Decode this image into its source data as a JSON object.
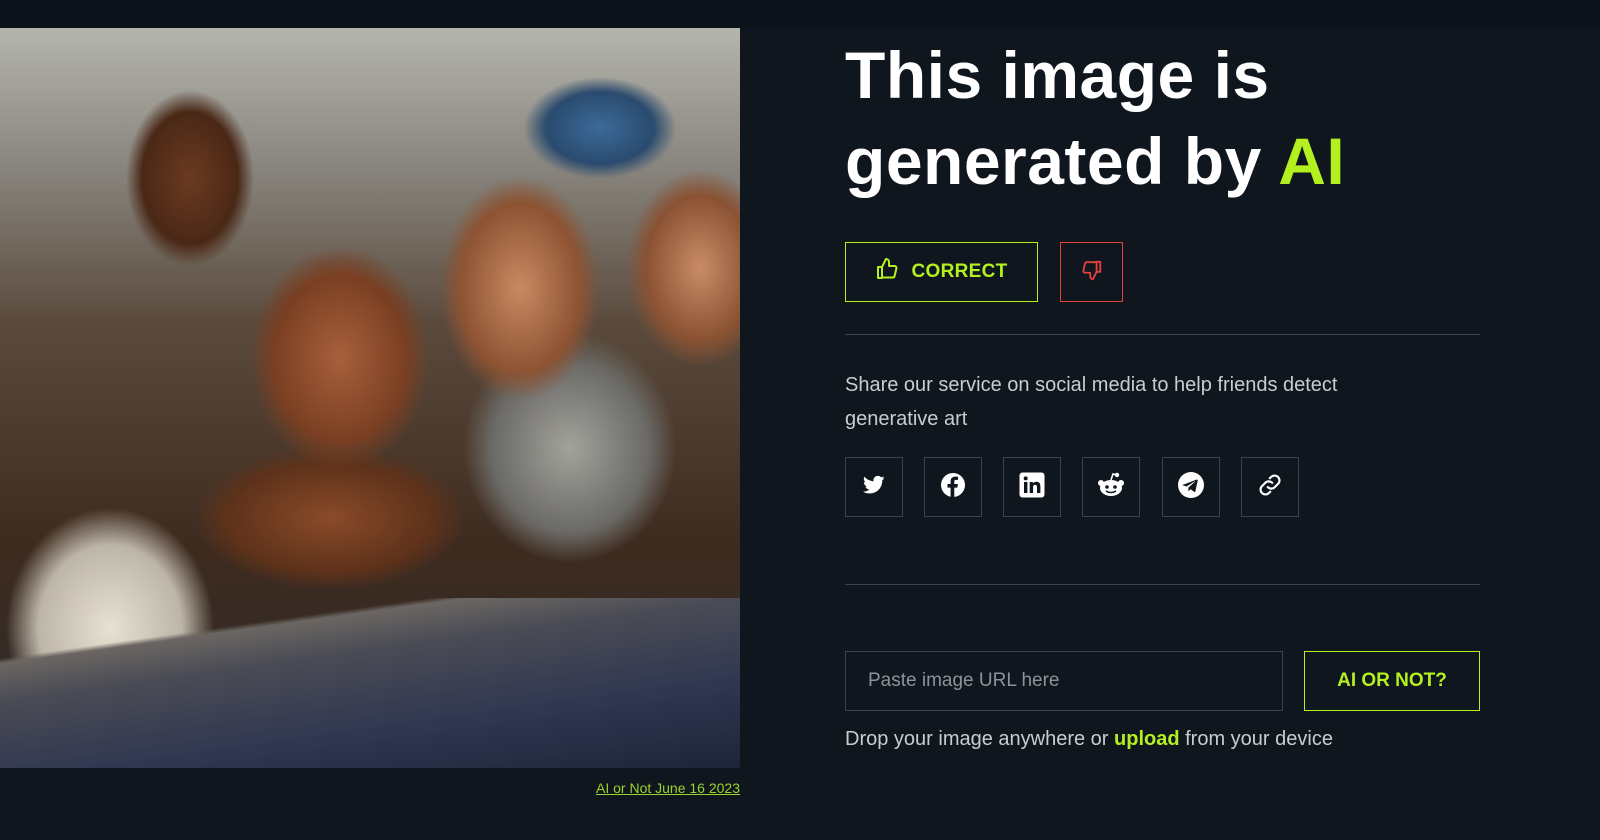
{
  "image_credit": "AI or Not June 16 2023",
  "result": {
    "headline_prefix": "This image is generated by ",
    "headline_highlight": "AI",
    "correct_label": "CORRECT"
  },
  "share": {
    "text": "Share our service on social media to help friends detect generative art",
    "networks": [
      "twitter-icon",
      "facebook-icon",
      "linkedin-icon",
      "reddit-icon",
      "telegram-icon",
      "link-icon"
    ]
  },
  "checker": {
    "url_placeholder": "Paste image URL here",
    "submit_label": "AI OR NOT?",
    "drop_prefix": "Drop your image anywhere or ",
    "upload_label": "upload",
    "drop_suffix": " from your device"
  },
  "colors": {
    "background": "#0f161e",
    "accent": "#b4f01f",
    "danger": "#e2413f",
    "border": "#3a424b"
  }
}
